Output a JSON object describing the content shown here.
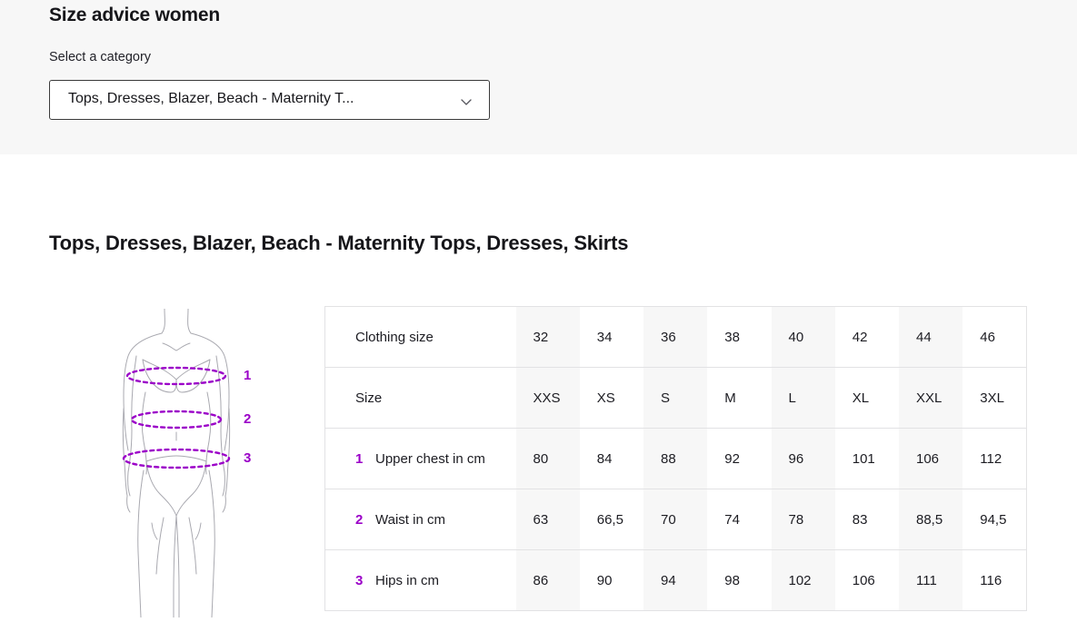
{
  "header": {
    "title": "Size advice women",
    "category_label": "Select a category",
    "category_value": "Tops, Dresses, Blazer, Beach - Maternity T...",
    "chevron_icon": "chevron-down-icon"
  },
  "section": {
    "title": "Tops, Dresses, Blazer, Beach - Maternity Tops, Dresses, Skirts"
  },
  "diagram": {
    "alt": "female-body-measurement-diagram",
    "markers": [
      {
        "number": "1",
        "meaning": "upper-chest"
      },
      {
        "number": "2",
        "meaning": "waist"
      },
      {
        "number": "3",
        "meaning": "hips"
      }
    ],
    "line_color": "#a9a9b0",
    "measure_color": "#9b00c8"
  },
  "table": {
    "rows": [
      {
        "marker": "",
        "label": "Clothing size",
        "values": [
          "32",
          "34",
          "36",
          "38",
          "40",
          "42",
          "44",
          "46"
        ]
      },
      {
        "marker": "",
        "label": "Size",
        "values": [
          "XXS",
          "XS",
          "S",
          "M",
          "L",
          "XL",
          "XXL",
          "3XL"
        ]
      },
      {
        "marker": "1",
        "label": "Upper chest in cm",
        "values": [
          "80",
          "84",
          "88",
          "92",
          "96",
          "101",
          "106",
          "112"
        ]
      },
      {
        "marker": "2",
        "label": "Waist in cm",
        "values": [
          "63",
          "66,5",
          "70",
          "74",
          "78",
          "83",
          "88,5",
          "94,5"
        ]
      },
      {
        "marker": "3",
        "label": "Hips in cm",
        "values": [
          "86",
          "90",
          "94",
          "98",
          "102",
          "106",
          "111",
          "116"
        ]
      }
    ]
  },
  "colors": {
    "accent_purple": "#9b00c8",
    "band_background": "#f7f7f7",
    "shaded_column": "#f7f7f7",
    "border": "#e2e2e4"
  }
}
